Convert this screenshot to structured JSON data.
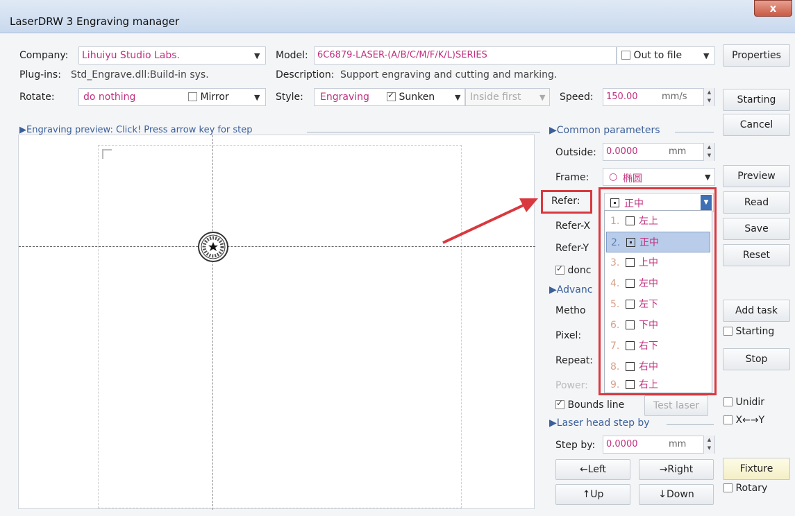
{
  "window": {
    "title": "LaserDRW 3 Engraving manager",
    "close_label": "x"
  },
  "top": {
    "company_label": "Company:",
    "company_value": "Lihuiyu Studio Labs.",
    "model_label": "Model:",
    "model_value": "6C6879-LASER-(A/B/C/M/F/K/L)SERIES",
    "out_to_file_label": "Out to file",
    "plugins_label": "Plug-ins:",
    "plugins_value": "Std_Engrave.dll:Build-in sys.",
    "description_label": "Description:",
    "description_value": "Support engraving and cutting and marking.",
    "rotate_label": "Rotate:",
    "rotate_value": "do nothing",
    "mirror_label": "Mirror",
    "style_label": "Style:",
    "style_value": "Engraving",
    "sunken_label": "Sunken",
    "inside_first_label": "Inside first",
    "speed_label": "Speed:",
    "speed_value": "150.00",
    "speed_unit": "mm/s"
  },
  "preview": {
    "header": "Engraving preview: Click! Press arrow key for step"
  },
  "common": {
    "header": "Common parameters",
    "outside_label": "Outside:",
    "outside_value": "0.0000",
    "outside_unit": "mm",
    "frame_label": "Frame:",
    "frame_value": "椭圆",
    "refer_label": "Refer:",
    "refer_value": "正中",
    "refer_x_label": "Refer-X",
    "refer_y_label": "Refer-Y",
    "done_label": "donc",
    "advanced_header": "Advanc",
    "method_label": "Metho",
    "pixel_label": "Pixel:",
    "repeat_label": "Repeat:",
    "power_label": "Power:",
    "bounds_line_label": "Bounds line",
    "test_laser_label": "Test laser",
    "laser_head_header": "Laser head step by",
    "step_by_label": "Step by:",
    "step_by_value": "0.0000",
    "step_by_unit": "mm",
    "left_label": "←Left",
    "right_label": "→Right",
    "up_label": "↑Up",
    "down_label": "↓Down"
  },
  "refer_dropdown": {
    "items": [
      {
        "num": "1.",
        "text": "左上"
      },
      {
        "num": "2.",
        "text": "正中"
      },
      {
        "num": "3.",
        "text": "上中"
      },
      {
        "num": "4.",
        "text": "左中"
      },
      {
        "num": "5.",
        "text": "左下"
      },
      {
        "num": "6.",
        "text": "下中"
      },
      {
        "num": "7.",
        "text": "右下"
      },
      {
        "num": "8.",
        "text": "右中"
      },
      {
        "num": "9.",
        "text": "右上"
      }
    ],
    "selected_index": 1
  },
  "right_buttons": {
    "properties": "Properties",
    "starting": "Starting",
    "cancel": "Cancel",
    "preview": "Preview",
    "read": "Read",
    "save": "Save",
    "reset": "Reset",
    "add_task": "Add task",
    "starting_check": "Starting",
    "stop": "Stop",
    "unidir": "Unidir",
    "xy": "X←→Y",
    "fixture": "Fixture",
    "rotary": "Rotary"
  },
  "colors": {
    "highlight_red": "#d9383e",
    "value_magenta": "#c0307f",
    "selected_row": "#b9cdea"
  }
}
